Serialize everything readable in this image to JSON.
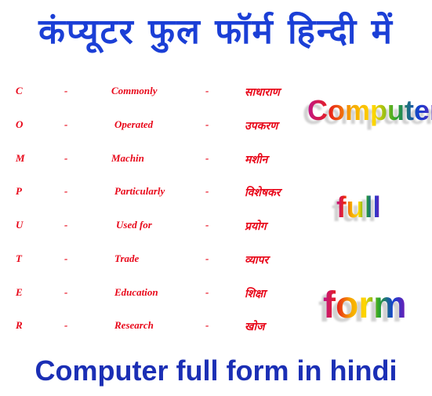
{
  "title_hindi": "कंप्यूटर फुल फॉर्म हिन्दी में",
  "rows": [
    {
      "letter": "C",
      "dash": "-",
      "english": "Commonly",
      "dash2": "-",
      "hindi": "साधाराण"
    },
    {
      "letter": "O",
      "dash": "-",
      "english": "Operated",
      "dash2": "-",
      "hindi": "उपकरण"
    },
    {
      "letter": "M",
      "dash": "-",
      "english": "Machin",
      "dash2": "-",
      "hindi": "मशीन"
    },
    {
      "letter": "P",
      "dash": "-",
      "english": "Particularly",
      "dash2": "-",
      "hindi": "विशेषकर"
    },
    {
      "letter": "U",
      "dash": "-",
      "english": "Used for",
      "dash2": "-",
      "hindi": "प्रयोग"
    },
    {
      "letter": "T",
      "dash": "-",
      "english": "Trade",
      "dash2": "-",
      "hindi": "व्यापर"
    },
    {
      "letter": "E",
      "dash": "-",
      "english": "Education",
      "dash2": "-",
      "hindi": "शिक्षा"
    },
    {
      "letter": "R",
      "dash": "-",
      "english": "Research",
      "dash2": "-",
      "hindi": "खोज"
    }
  ],
  "word_art": [
    "Computer",
    "full",
    "form"
  ],
  "title_english": "Computer full form in hindi",
  "colors": {
    "title": "#1b3fd6",
    "rows": "#e8081a"
  }
}
